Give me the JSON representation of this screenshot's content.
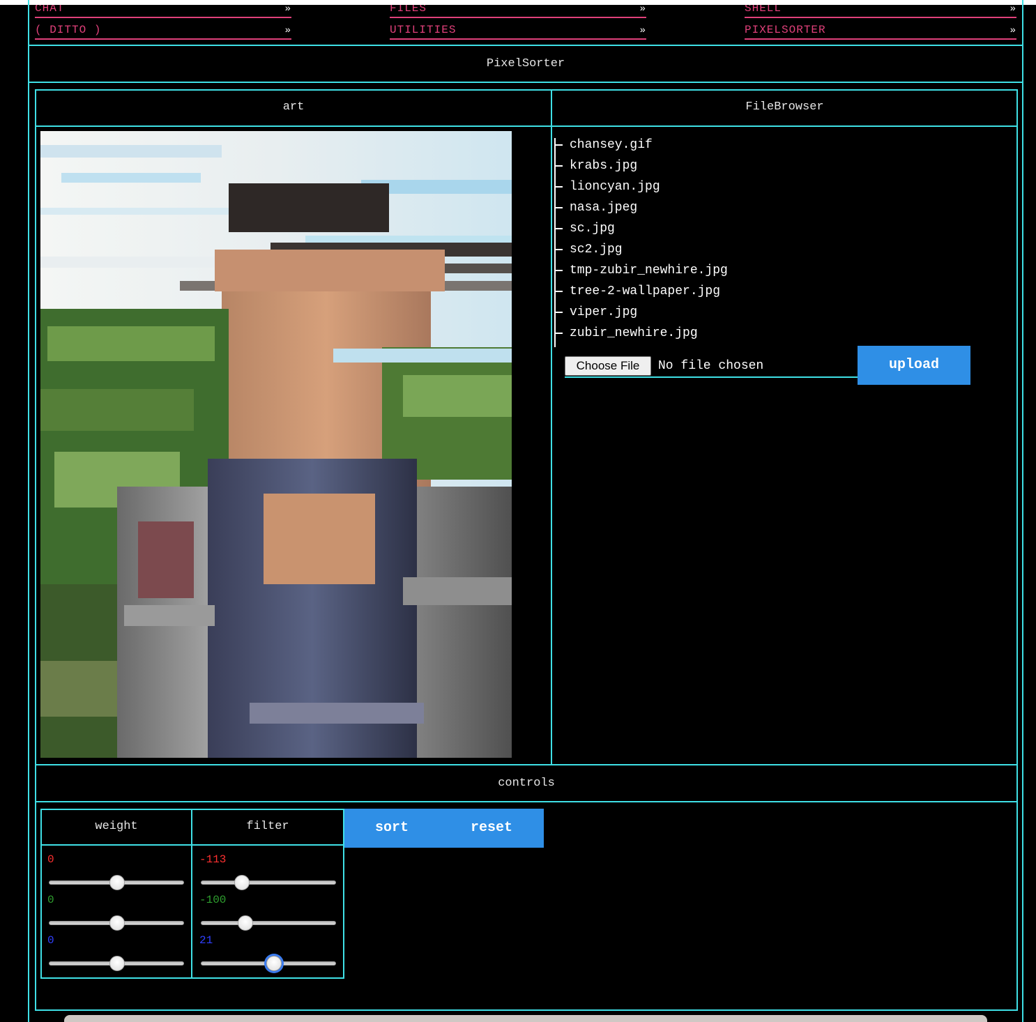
{
  "nav": {
    "row1": [
      {
        "label": "CHAT",
        "arrow": "»"
      },
      {
        "label": "FILES",
        "arrow": "»"
      },
      {
        "label": "SHELL",
        "arrow": "»"
      }
    ],
    "row2": [
      {
        "label": "( DITTO )",
        "arrow": "»"
      },
      {
        "label": "UTILITIES",
        "arrow": "»"
      },
      {
        "label": "PIXELSORTER",
        "arrow": "»"
      }
    ]
  },
  "page_title": "PixelSorter",
  "art": {
    "title": "art"
  },
  "filebrowser": {
    "title": "FileBrowser",
    "files": [
      "chansey.gif",
      "krabs.jpg",
      "lioncyan.jpg",
      "nasa.jpeg",
      "sc.jpg",
      "sc2.jpg",
      "tmp-zubir_newhire.jpg",
      "tree-2-wallpaper.jpg",
      "viper.jpg",
      "zubir_newhire.jpg"
    ],
    "choose_label": "Choose File",
    "no_file": "No file chosen",
    "upload_label": "upload"
  },
  "controls": {
    "title": "controls",
    "weight": {
      "title": "weight",
      "values": [
        {
          "label": "0",
          "value": 0,
          "min": -255,
          "max": 255,
          "color": "#ff3030"
        },
        {
          "label": "0",
          "value": 0,
          "min": -255,
          "max": 255,
          "color": "#2fa02f"
        },
        {
          "label": "0",
          "value": 0,
          "min": -255,
          "max": 255,
          "color": "#3040ff"
        }
      ]
    },
    "filter": {
      "title": "filter",
      "values": [
        {
          "label": "-113",
          "value": -113,
          "min": -255,
          "max": 255,
          "color": "#ff3030"
        },
        {
          "label": "-100",
          "value": -100,
          "min": -255,
          "max": 255,
          "color": "#2fa02f"
        },
        {
          "label": "21",
          "value": 21,
          "min": -255,
          "max": 255,
          "color": "#3040ff"
        }
      ]
    },
    "sort_label": "sort",
    "reset_label": "reset"
  },
  "colors": {
    "accent": "#3fe0e6",
    "nav": "#e0407a",
    "button": "#2f8fe6"
  }
}
